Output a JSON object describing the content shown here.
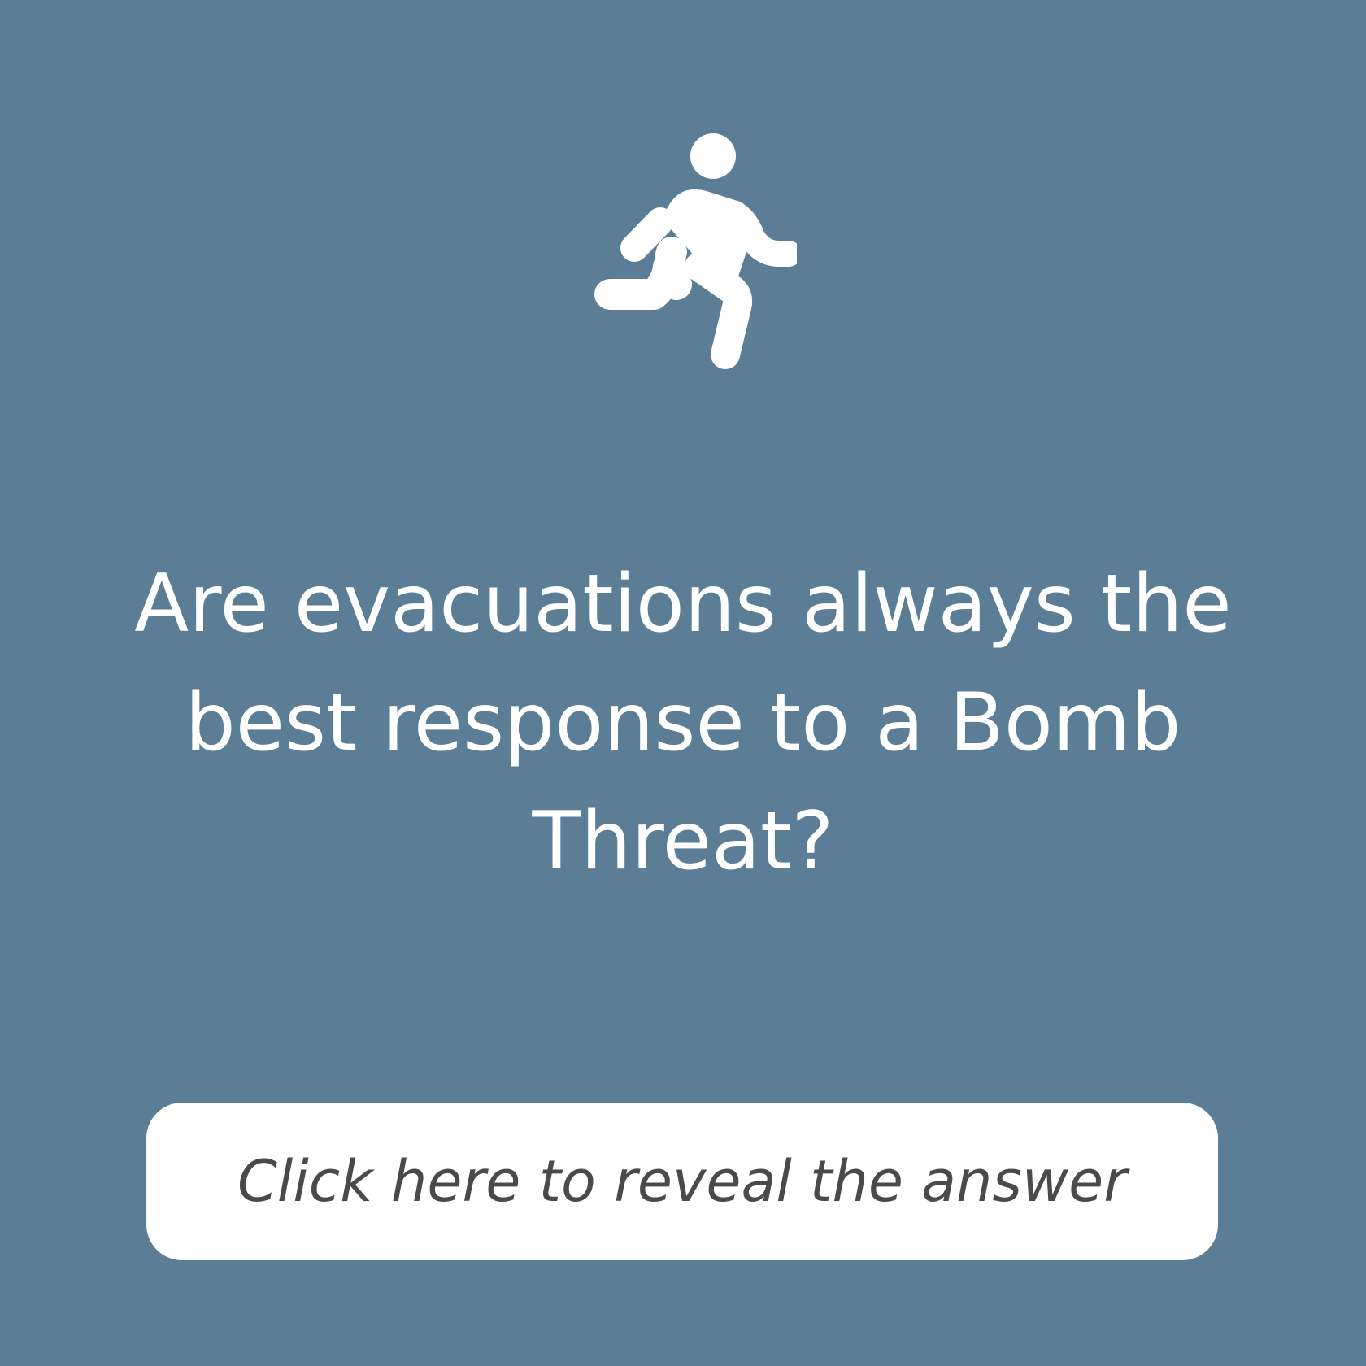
{
  "theme": {
    "background": "#5b7d96",
    "foreground": "#ffffff",
    "button_text": "#4a4a4a"
  },
  "icon": {
    "name": "running-person-icon"
  },
  "question": {
    "text": "Are evacuations always the best response to a Bomb Threat?"
  },
  "reveal_button": {
    "label": "Click here to reveal the answer"
  }
}
